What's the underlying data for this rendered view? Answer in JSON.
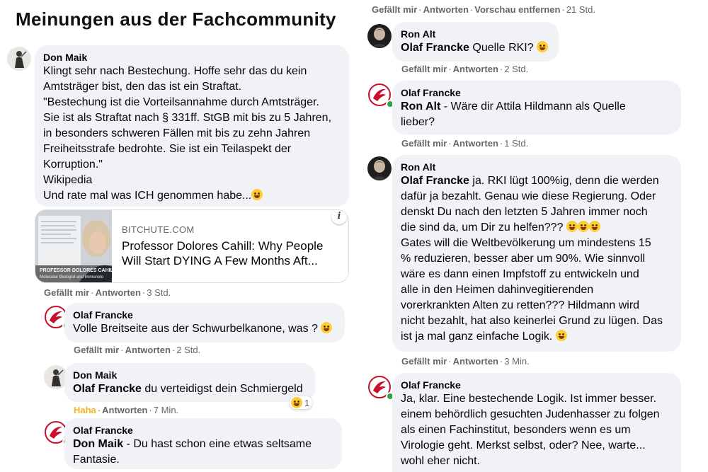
{
  "page_title": "Meinungen aus der Fachcommunity",
  "left": {
    "c1": {
      "author": "Don Maik",
      "text": "Klingt sehr nach Bestechung. Hoffe sehr das du kein\nAmtsträger bist, den das ist ein Straftat.\n\"Bestechung ist die Vorteilsannahme durch Amtsträger.\nSie ist als Straftat nach § 331ff. StGB mit bis zu 5 Jahren,\nin besonders schweren Fällen mit bis zu zehn Jahren\nFreiheitsstrafe bedrohte. Sie ist ein Teilaspekt der\nKorruption.\"\nWikipedia\nUnd rate mal was ICH genommen habe...",
      "link_domain": "BITCHUTE.COM",
      "link_title": "Professor Dolores Cahill: Why People Will Start DYING A Few Months Aft...",
      "thumb_caption": "PROFESSOR DOLORES CAHILL",
      "thumb_subcaption": "Molecular Biologist and Immunolo",
      "like": "Gefällt mir",
      "reply": "Antworten",
      "time": "3 Std."
    },
    "c2": {
      "author": "Olaf Francke",
      "text": "Volle Breitseite aus der Schwurbelkanone, was ?",
      "like": "Gefällt mir",
      "reply": "Antworten",
      "time": "2 Std."
    },
    "c3": {
      "author": "Don Maik",
      "mention": "Olaf Francke",
      "text": " du verteidigst dein Schmiergeld",
      "reaction": "Haha",
      "reply": "Antworten",
      "time": "7 Min.",
      "reaction_count": "1"
    },
    "c4": {
      "author": "Olaf Francke",
      "mention": "Don Maik",
      "text": " - Du hast schon eine etwas seltsame\nFantasie."
    }
  },
  "right": {
    "top_actions": {
      "like": "Gefällt mir",
      "reply": "Antworten",
      "remove_preview": "Vorschau entfernen",
      "time": "21 Std."
    },
    "r1": {
      "author": "Ron Alt",
      "mention": "Olaf Francke",
      "text": " Quelle RKI?",
      "like": "Gefällt mir",
      "reply": "Antworten",
      "time": "2 Std."
    },
    "r2": {
      "author": "Olaf Francke",
      "mention": "Ron Alt",
      "text": " - Wäre dir Attila Hildmann als Quelle\nlieber?",
      "like": "Gefällt mir",
      "reply": "Antworten",
      "time": "1 Std."
    },
    "r3": {
      "author": "Ron Alt",
      "mention": "Olaf Francke",
      "text": " ja. RKI lügt 100%ig, denn die werden\ndafür ja bezahlt. Genau wie diese Regierung. Oder\ndenskt Du nach den letzten 5 Jahren immer noch\ndie sind da, um Dir zu helfen???",
      "text2": "Gates will die Weltbevölkerung um mindestens 15\n% reduzieren, besser aber um 90%. Wie sinnvoll\nwäre es dann einen Impfstoff zu entwickeln und\nalle in den Heimen dahinvegitierenden\nvorerkrankten Alten zu retten??? Hildmann wird\nnicht bezahlt, hat also keinerlei Grund zu lügen. Das\nist ja mal ganz einfache Logik.",
      "like": "Gefällt mir",
      "reply": "Antworten",
      "time": "3 Min."
    },
    "r4": {
      "author": "Olaf Francke",
      "text": "Ja, klar. Eine bestechende Logik. Ist immer besser.\neinem behördlich gesuchten Judenhasser zu folgen\nals einen Fachinstitut, besonders wenn es um\nVirologie geht. Merkst selbst, oder? Nee, warte...\nwohl eher nicht."
    }
  },
  "colors": {
    "bubble": "#f0f2f5",
    "meta": "#65676b",
    "haha": "#f7b125",
    "online": "#31a24c"
  },
  "icons": {
    "avatar_don": "knight-statue-avatar",
    "avatar_olaf": "red-eagle-logo-avatar",
    "avatar_ron": "man-photo-avatar",
    "info": "info-icon",
    "emoji": "grinning-emoji"
  }
}
